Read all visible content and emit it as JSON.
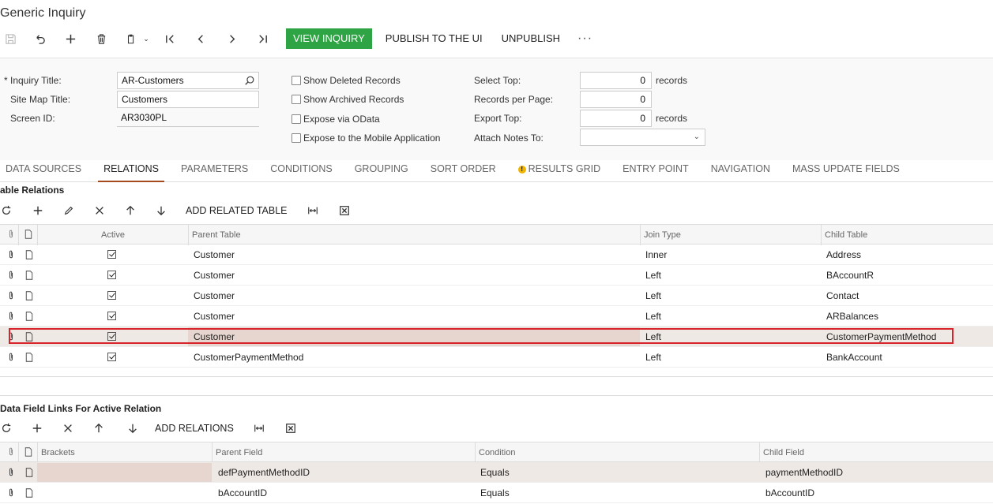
{
  "page": {
    "title": "Generic Inquiry"
  },
  "toolbar": {
    "icons": [
      "save-icon",
      "undo-icon",
      "add-icon",
      "delete-icon",
      "copy-paste-icon",
      "first-icon",
      "previous-icon",
      "next-icon",
      "last-icon"
    ],
    "view_inquiry": "VIEW INQUIRY",
    "publish": "PUBLISH TO THE UI",
    "unpublish": "UNPUBLISH",
    "more": "···"
  },
  "form": {
    "inquiry_title_label": "Inquiry Title:",
    "inquiry_title_required": "*",
    "inquiry_title_value": "AR-Customers",
    "site_map_title_label": "Site Map Title:",
    "site_map_title_value": "Customers",
    "screen_id_label": "Screen ID:",
    "screen_id_value": "AR3030PL",
    "show_deleted": "Show Deleted Records",
    "show_archived": "Show Archived Records",
    "expose_odata": "Expose via OData",
    "expose_mobile": "Expose to the Mobile Application",
    "select_top_label": "Select Top:",
    "select_top_value": "0",
    "select_top_unit": "records",
    "records_per_page_label": "Records per Page:",
    "records_per_page_value": "0",
    "export_top_label": "Export Top:",
    "export_top_value": "0",
    "export_top_unit": "records",
    "attach_notes_label": "Attach Notes To:",
    "attach_notes_value": ""
  },
  "tabs": [
    {
      "label": "DATA SOURCES"
    },
    {
      "label": "RELATIONS",
      "active": true
    },
    {
      "label": "PARAMETERS"
    },
    {
      "label": "CONDITIONS"
    },
    {
      "label": "GROUPING"
    },
    {
      "label": "SORT ORDER"
    },
    {
      "label": "RESULTS GRID",
      "warning": true
    },
    {
      "label": "ENTRY POINT"
    },
    {
      "label": "NAVIGATION"
    },
    {
      "label": "MASS UPDATE FIELDS"
    }
  ],
  "relations": {
    "title": "able Relations",
    "add_related_table": "ADD RELATED TABLE",
    "columns": {
      "active": "Active",
      "parent_table": "Parent Table",
      "join_type": "Join Type",
      "child_table": "Child Table"
    },
    "rows": [
      {
        "parent": "Customer",
        "join": "Inner",
        "child": "Address"
      },
      {
        "parent": "Customer",
        "join": "Left",
        "child": "BAccountR"
      },
      {
        "parent": "Customer",
        "join": "Left",
        "child": "Contact"
      },
      {
        "parent": "Customer",
        "join": "Left",
        "child": "ARBalances"
      },
      {
        "parent": "Customer",
        "join": "Left",
        "child": "CustomerPaymentMethod"
      },
      {
        "parent": "CustomerPaymentMethod",
        "join": "Left",
        "child": "BankAccount"
      }
    ]
  },
  "links": {
    "title": "Data Field Links For Active Relation",
    "add_relations": "ADD RELATIONS",
    "columns": {
      "brackets": "Brackets",
      "parent_field": "Parent Field",
      "condition": "Condition",
      "child_field": "Child Field"
    },
    "rows": [
      {
        "parent": "defPaymentMethodID",
        "condition": "Equals",
        "child": "paymentMethodID"
      },
      {
        "parent": "bAccountID",
        "condition": "Equals",
        "child": "bAccountID"
      }
    ]
  }
}
